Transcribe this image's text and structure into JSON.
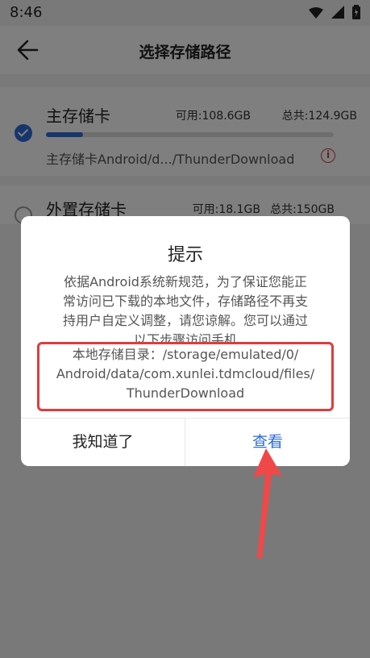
{
  "status_bar": {
    "time": "8:46",
    "icons": [
      "wifi-icon",
      "signal-icon",
      "battery-icon"
    ]
  },
  "header": {
    "back_icon": "arrow-left-icon",
    "title": "选择存储路径"
  },
  "storage_cards": [
    {
      "name": "主存储卡",
      "available": "可用:108.6GB",
      "total": "总共:124.9GB",
      "used_fraction": 0.13,
      "path": "主存储卡Android/d.../ThunderDownload",
      "selected": true
    },
    {
      "name": "外置存储卡",
      "available": "可用:18.1GB",
      "total": "总共:150GB",
      "selected": false
    }
  ],
  "dialog": {
    "title": "提示",
    "message": "依据Android系统新规范，为了保证您能正常访问已下载的本地文件，存储路径不再支持用户自定义调整，请您谅解。您可以通过以下步骤访问手机",
    "path_lines": [
      "本地存储目录：/storage/emulated/0/",
      "Android/data/com.xunlei.tdmcloud/files/",
      "ThunderDownload"
    ],
    "dismiss_label": "我知道了",
    "view_label": "查看"
  },
  "colors": {
    "accent": "#2f6bd8",
    "highlight": "#e03c3c",
    "overlay": "rgba(0,0,0,0.5)"
  }
}
